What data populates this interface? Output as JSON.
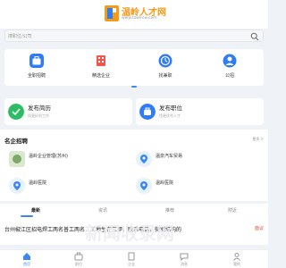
{
  "header": {
    "logo_text": "温岭人才网",
    "logo_url": "www.tzwlrcw.com"
  },
  "search": {
    "placeholder": "搜职位/公司"
  },
  "quick_menu": [
    {
      "label": "全职招聘",
      "icon": "briefcase-icon",
      "color": "#2f7cf6"
    },
    {
      "label": "精选企业",
      "icon": "building-icon",
      "color": "#f2554a"
    },
    {
      "label": "找兼职",
      "icon": "clock-icon",
      "color": "#2f7cf6"
    },
    {
      "label": "公招",
      "icon": "person-icon",
      "color": "#2f7cf6"
    }
  ],
  "publish": {
    "resume": {
      "title": "发布简历",
      "subtitle": "找更好的工作",
      "color": "#2cbc63"
    },
    "job": {
      "title": "发布职位",
      "subtitle": "找更优秀人才",
      "color": "#2f7cf6"
    }
  },
  "famous": {
    "title": "名企招聘",
    "more": "更多 >",
    "companies": [
      {
        "name": "温岭企业管理(苏州)",
        "subtitle": ""
      },
      {
        "name": "温泉汽车贸易",
        "subtitle": ""
      },
      {
        "name": "温岭医院",
        "subtitle": ""
      },
      {
        "name": "温岭医院",
        "subtitle": ""
      }
    ]
  },
  "tabs": [
    "最新",
    "资讯",
    "推荐",
    "附近"
  ],
  "news": {
    "text": "台州椒江区招电焊工两名普工两名，工地生在三甲，联系电话，微钢结构的",
    "tag": "面议"
  },
  "watermark": "新闻收录网",
  "bottom_nav": [
    {
      "label": "首页",
      "icon": "home-icon"
    },
    {
      "label": "职位",
      "icon": "briefcase-icon"
    },
    {
      "label": "企业",
      "icon": "building-icon"
    },
    {
      "label": "消息",
      "icon": "message-icon"
    },
    {
      "label": "我的",
      "icon": "user-icon"
    }
  ],
  "colors": {
    "accent": "#3a86f7",
    "tag": "#e04b3a"
  }
}
